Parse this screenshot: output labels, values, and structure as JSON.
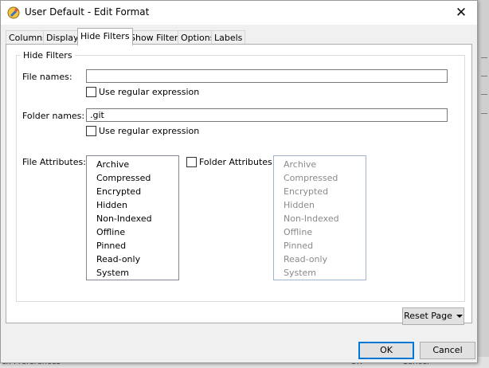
{
  "window": {
    "title": "User Default - Edit Format"
  },
  "tabs": [
    {
      "label": "Columns"
    },
    {
      "label": "Display"
    },
    {
      "label": "Hide Filters"
    },
    {
      "label": "Show Filters"
    },
    {
      "label": "Options"
    },
    {
      "label": "Labels"
    }
  ],
  "active_tab": "Hide Filters",
  "hide_filters": {
    "group_title": "Hide Filters",
    "file_names": {
      "label": "File names:",
      "value": "",
      "regex_label": "Use regular expression",
      "regex_checked": false
    },
    "folder_names": {
      "label": "Folder names:",
      "value": ".git",
      "regex_label": "Use regular expression",
      "regex_checked": false
    },
    "file_attributes": {
      "label": "File Attributes:",
      "items": [
        "Archive",
        "Compressed",
        "Encrypted",
        "Hidden",
        "Non-Indexed",
        "Offline",
        "Pinned",
        "Read-only",
        "System"
      ]
    },
    "folder_attributes": {
      "label": "Folder Attributes:",
      "checked": false,
      "items": [
        "Archive",
        "Compressed",
        "Encrypted",
        "Hidden",
        "Non-Indexed",
        "Offline",
        "Pinned",
        "Read-only",
        "System"
      ]
    }
  },
  "buttons": {
    "reset_page": "Reset Page",
    "ok": "OK",
    "cancel": "Cancel"
  },
  "background": {
    "left_text": "cn Preferences",
    "ok_text": "OK",
    "cancel_text": "Cancel"
  },
  "icons": {
    "app": "app-icon",
    "close": "close-icon",
    "dropdown": "chevron-down-icon"
  },
  "colors": {
    "dialog_bg": "#f0f0f0",
    "panel_bg": "#ffffff",
    "default_button_border": "#0078d7",
    "disabled_text": "#8a8a8a"
  }
}
